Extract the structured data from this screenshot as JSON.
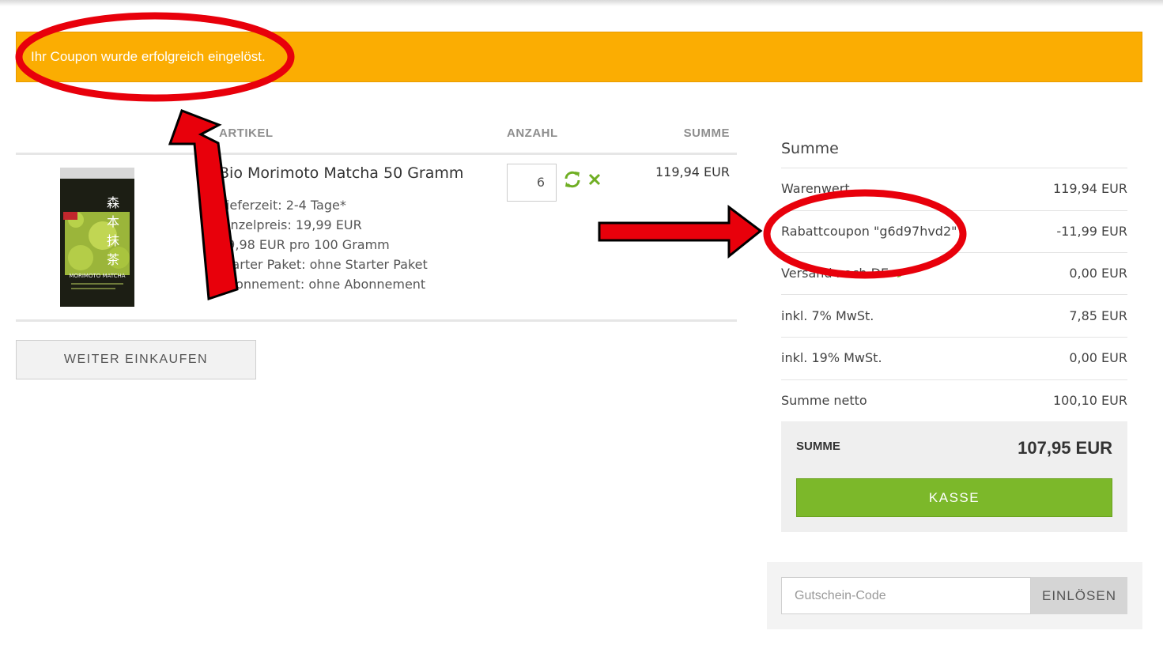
{
  "alert": {
    "message": "Ihr Coupon wurde erfolgreich eingelöst."
  },
  "cart": {
    "headers": {
      "article": "ARTIKEL",
      "quantity": "ANZAHL",
      "sum": "SUMME"
    },
    "item": {
      "name": "Bio Morimoto Matcha 50 Gramm",
      "image_label": "MORIMOTO MATCHA",
      "image_kanji": [
        "森",
        "本",
        "抹",
        "茶"
      ],
      "attributes": [
        "Lieferzeit: 2-4 Tage*",
        "Einzelpreis: 19,99 EUR",
        "39,98 EUR pro 100 Gramm",
        "Starter Paket: ohne Starter Paket",
        "Abonnement: ohne Abonnement"
      ],
      "quantity": "6",
      "line_total": "119,94 EUR"
    },
    "continue_label": "WEITER EINKAUFEN"
  },
  "summary": {
    "title": "Summe",
    "rows": [
      {
        "label": "Warenwert",
        "value": "119,94 EUR"
      },
      {
        "label": "Rabattcoupon \"g6d97hvd2\"",
        "value": "-11,99 EUR"
      },
      {
        "label": "Versand nach DE",
        "value": "0,00 EUR"
      },
      {
        "label": "inkl. 7% MwSt.",
        "value": "7,85 EUR"
      },
      {
        "label": "inkl. 19% MwSt.",
        "value": "0,00 EUR"
      },
      {
        "label": "Summe netto",
        "value": "100,10 EUR"
      }
    ],
    "total_label": "SUMME",
    "total_value": "107,95 EUR",
    "checkout_label": "KASSE"
  },
  "coupon": {
    "placeholder": "Gutschein-Code",
    "button_label": "EINLÖSEN"
  },
  "colors": {
    "alert": "#fbad02",
    "accent_green": "#7cb82a",
    "annotation_red": "#e8000b"
  },
  "icons": [
    "refresh-icon",
    "remove-icon",
    "pencil-icon"
  ]
}
